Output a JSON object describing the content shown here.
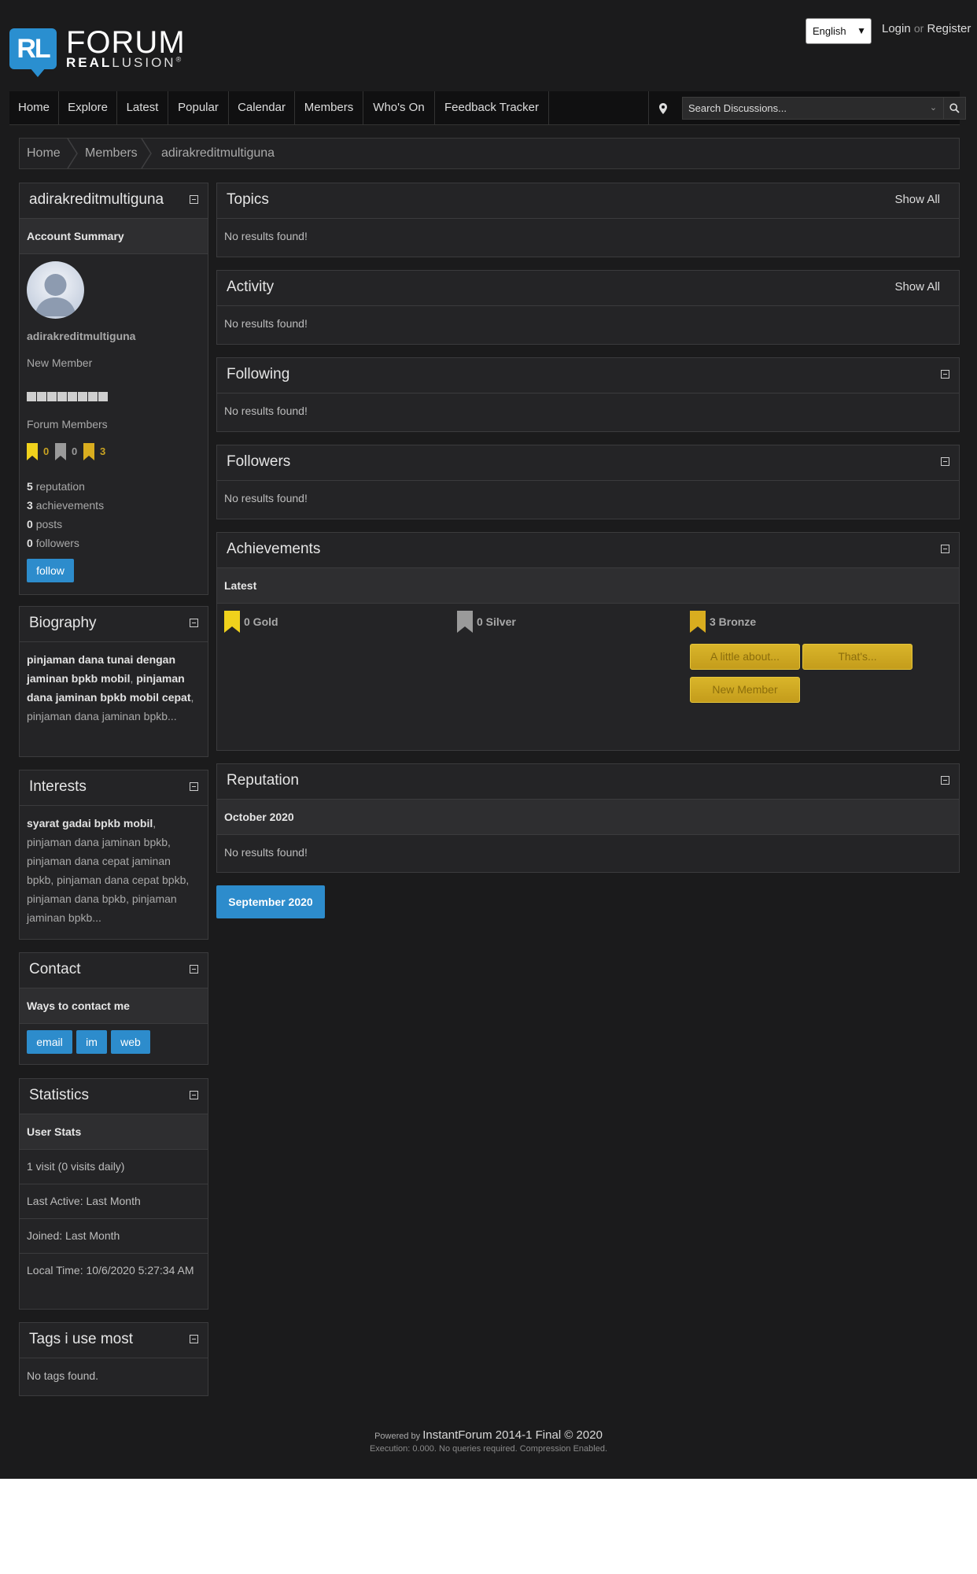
{
  "header": {
    "logo": {
      "badge": "RL",
      "forum": "FORUM",
      "real": "REAL",
      "lusion": "LUSION",
      "reg": "®"
    },
    "language": "English",
    "login": "Login",
    "or": "or",
    "register": "Register"
  },
  "nav": {
    "items": [
      "Home",
      "Explore",
      "Latest",
      "Popular",
      "Calendar",
      "Members",
      "Who's On",
      "Feedback Tracker"
    ],
    "search_placeholder": "Search Discussions..."
  },
  "breadcrumb": [
    "Home",
    "Members",
    "adirakreditmultiguna"
  ],
  "profile": {
    "title": "adirakreditmultiguna",
    "summary_label": "Account Summary",
    "username": "adirakreditmultiguna",
    "rank": "New Member",
    "group": "Forum Members",
    "medals": {
      "gold": "0",
      "silver": "0",
      "bronze": "3"
    },
    "reputation_count": "5",
    "reputation_label": "reputation",
    "achievements_count": "3",
    "achievements_label": "achievements",
    "posts_count": "0",
    "posts_label": "posts",
    "followers_count": "0",
    "followers_label": "followers",
    "follow_button": "follow"
  },
  "biography": {
    "title": "Biography",
    "b1": "pinjaman dana tunai dengan jaminan bpkb mobil",
    "comma1": ", ",
    "b2": "pinjaman dana jaminan bpkb mobil cepat",
    "rest": ", pinjaman dana jaminan bpkb..."
  },
  "interests": {
    "title": "Interests",
    "b1": "syarat gadai bpkb mobil",
    "rest": ", pinjaman dana jaminan bpkb, pinjaman dana cepat jaminan bpkb, pinjaman dana cepat bpkb, pinjaman dana bpkb, pinjaman jaminan bpkb..."
  },
  "contact": {
    "title": "Contact",
    "sub": "Ways to contact me",
    "buttons": [
      "email",
      "im",
      "web"
    ]
  },
  "statistics": {
    "title": "Statistics",
    "sub": "User Stats",
    "rows": [
      "1 visit (0 visits daily)",
      "Last Active: Last Month",
      "Joined: Last Month",
      "Local Time: 10/6/2020 5:27:34 AM"
    ]
  },
  "tags": {
    "title": "Tags i use most",
    "empty": "No tags found."
  },
  "topics": {
    "title": "Topics",
    "show_all": "Show All",
    "empty": "No results found!"
  },
  "activity": {
    "title": "Activity",
    "show_all": "Show All",
    "empty": "No results found!"
  },
  "following": {
    "title": "Following",
    "empty": "No results found!"
  },
  "followers": {
    "title": "Followers",
    "empty": "No results found!"
  },
  "achievements": {
    "title": "Achievements",
    "sub": "Latest",
    "gold": "0 Gold",
    "silver": "0 Silver",
    "bronze": "3 Bronze",
    "badges": [
      "A little about...",
      "That's...",
      "New Member"
    ]
  },
  "reputation": {
    "title": "Reputation",
    "month": "October 2020",
    "empty": "No results found!",
    "prev_month": "September 2020"
  },
  "footer": {
    "powered_by": "Powered by",
    "product": "InstantForum 2014-1 Final © 2020",
    "exec": "Execution: 0.000. No queries required. Compression Enabled."
  },
  "colors": {
    "accent": "#2d8ccc",
    "gold": "#e8c11a",
    "silver": "#9a9a9a",
    "bronze": "#d9ad1f",
    "background": "#1b1b1c"
  }
}
